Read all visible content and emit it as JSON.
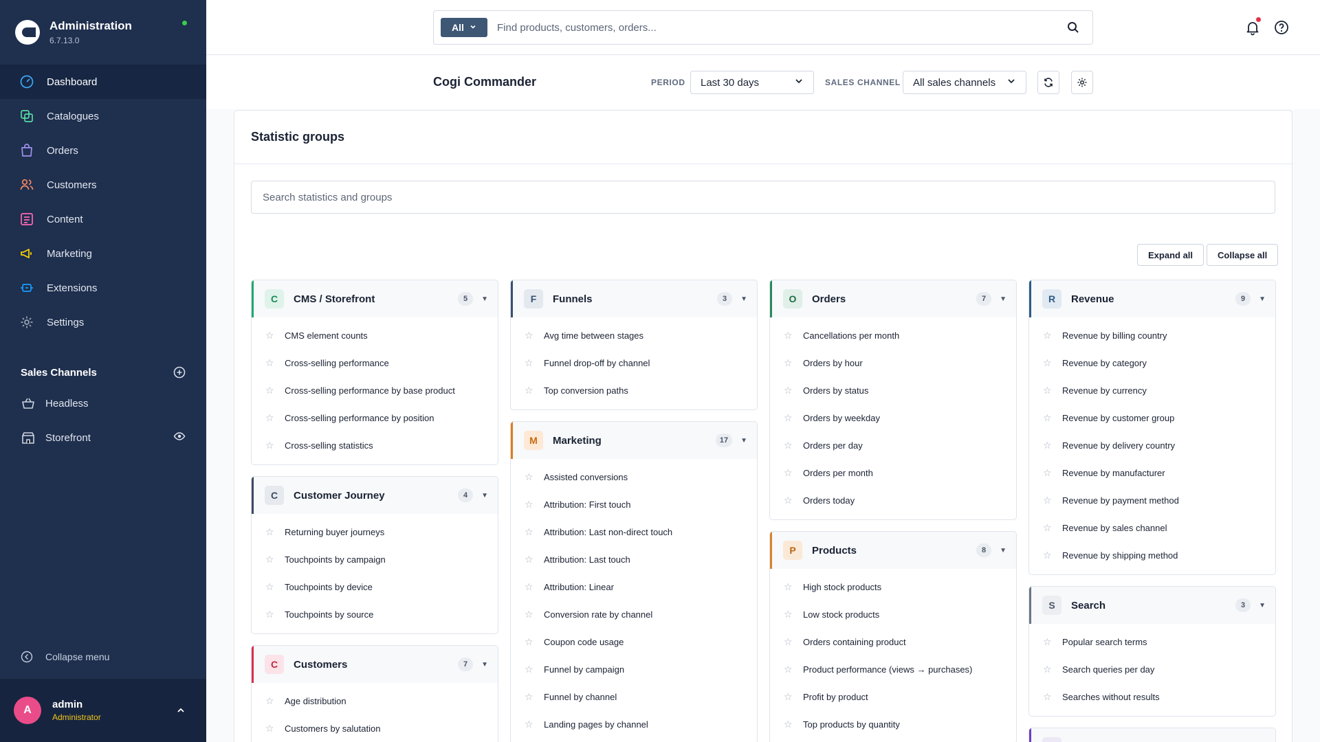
{
  "sidebar": {
    "brand_title": "Administration",
    "brand_version": "6.7.13.0",
    "nav": [
      {
        "label": "Dashboard",
        "icon": "dashboard-icon",
        "color": "#3fa9f5"
      },
      {
        "label": "Catalogues",
        "icon": "catalogue-icon",
        "color": "#57d9a3"
      },
      {
        "label": "Orders",
        "icon": "orders-icon",
        "color": "#a092f0"
      },
      {
        "label": "Customers",
        "icon": "customers-icon",
        "color": "#f88962"
      },
      {
        "label": "Content",
        "icon": "content-icon",
        "color": "#ff68b4"
      },
      {
        "label": "Marketing",
        "icon": "marketing-icon",
        "color": "#ffd700"
      },
      {
        "label": "Extensions",
        "icon": "extensions-icon",
        "color": "#189eff"
      },
      {
        "label": "Settings",
        "icon": "settings-icon",
        "color": "#9aa8b5"
      }
    ],
    "sales_channels_title": "Sales Channels",
    "sales_channels": [
      {
        "label": "Headless",
        "icon": "basket-icon"
      },
      {
        "label": "Storefront",
        "icon": "storefront-icon"
      }
    ],
    "collapse_label": "Collapse menu",
    "user": {
      "initial": "A",
      "name": "admin",
      "role": "Administrator"
    }
  },
  "topbar": {
    "search_type": "All",
    "search_placeholder": "Find products, customers, orders..."
  },
  "dashboard": {
    "title": "Cogi Commander",
    "period_label": "PERIOD",
    "period_value": "Last 30 days",
    "channel_label": "SALES CHANNEL",
    "channel_value": "All sales channels"
  },
  "panel": {
    "title": "Statistic groups",
    "search_placeholder": "Search statistics and groups",
    "expand_all": "Expand all",
    "collapse_all": "Collapse all"
  },
  "columns": [
    [
      {
        "letter": "C",
        "name": "CMS / Storefront",
        "count": "5",
        "accent": "#1fa86f",
        "badge_bg": "#dff3ea",
        "badge_fg": "#178a5a",
        "items": [
          "CMS element counts",
          "Cross-selling performance",
          "Cross-selling performance by base product",
          "Cross-selling performance by position",
          "Cross-selling statistics"
        ]
      },
      {
        "letter": "C",
        "name": "Customer Journey",
        "count": "4",
        "accent": "#3b4a63",
        "badge_bg": "#e6e9ee",
        "badge_fg": "#3b4a63",
        "items": [
          "Returning buyer journeys",
          "Touchpoints by campaign",
          "Touchpoints by device",
          "Touchpoints by source"
        ]
      },
      {
        "letter": "C",
        "name": "Customers",
        "count": "7",
        "accent": "#d9304f",
        "badge_bg": "#fbe3e8",
        "badge_fg": "#c02848",
        "items": [
          "Age distribution",
          "Customers by salutation"
        ]
      }
    ],
    [
      {
        "letter": "F",
        "name": "Funnels",
        "count": "3",
        "accent": "#3a5070",
        "badge_bg": "#e4e9f0",
        "badge_fg": "#3a5070",
        "items": [
          "Avg time between stages",
          "Funnel drop-off by channel",
          "Top conversion paths"
        ]
      },
      {
        "letter": "M",
        "name": "Marketing",
        "count": "17",
        "accent": "#e07b1a",
        "badge_bg": "#fde9d6",
        "badge_fg": "#c96a10",
        "items": [
          "Assisted conversions",
          "Attribution: First touch",
          "Attribution: Last non-direct touch",
          "Attribution: Last touch",
          "Attribution: Linear",
          "Conversion rate by channel",
          "Coupon code usage",
          "Funnel by campaign",
          "Funnel by channel",
          "Landing pages by channel"
        ]
      }
    ],
    [
      {
        "letter": "O",
        "name": "Orders",
        "count": "7",
        "accent": "#2a8a5c",
        "badge_bg": "#e0efe7",
        "badge_fg": "#216e49",
        "items": [
          "Cancellations per month",
          "Orders by hour",
          "Orders by status",
          "Orders by weekday",
          "Orders per day",
          "Orders per month",
          "Orders today"
        ]
      },
      {
        "letter": "P",
        "name": "Products",
        "count": "8",
        "accent": "#d9822b",
        "badge_bg": "#fbe9d7",
        "badge_fg": "#b8661a",
        "items": [
          "High stock products",
          "Low stock products",
          "Orders containing product",
          "Product performance (views → purchases)",
          "Profit by product",
          "Top products by quantity"
        ]
      }
    ],
    [
      {
        "letter": "R",
        "name": "Revenue",
        "count": "9",
        "accent": "#2e5b8a",
        "badge_bg": "#e1e9f2",
        "badge_fg": "#2e5b8a",
        "items": [
          "Revenue by billing country",
          "Revenue by category",
          "Revenue by currency",
          "Revenue by customer group",
          "Revenue by delivery country",
          "Revenue by manufacturer",
          "Revenue by payment method",
          "Revenue by sales channel",
          "Revenue by shipping method"
        ]
      },
      {
        "letter": "S",
        "name": "Search",
        "count": "3",
        "accent": "#6b7687",
        "badge_bg": "#eceef1",
        "badge_fg": "#4b5567",
        "items": [
          "Popular search terms",
          "Search queries per day",
          "Searches without results"
        ]
      },
      {
        "letter": "",
        "name": "",
        "count": "",
        "accent": "#6a3fc9",
        "badge_bg": "#ece8f6",
        "badge_fg": "#6a3fc9",
        "items": []
      }
    ]
  ]
}
